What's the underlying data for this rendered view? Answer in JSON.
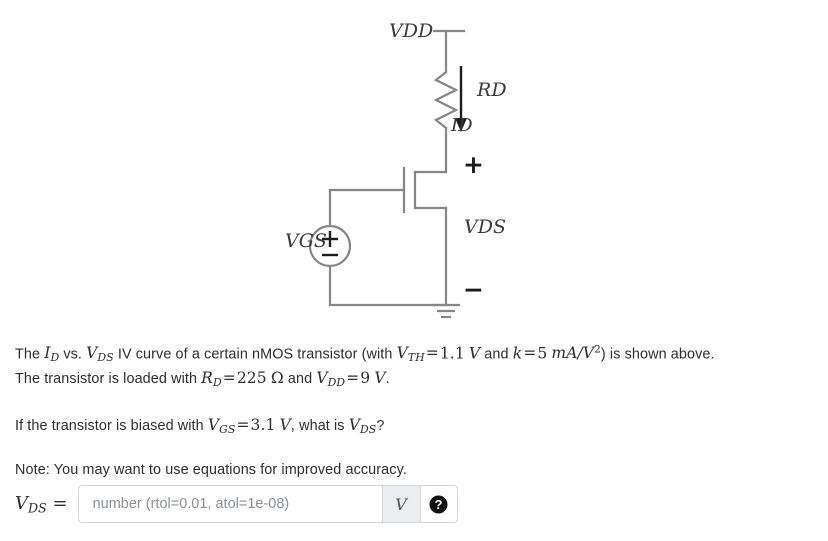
{
  "circuit": {
    "title": "nMOS common-source amplifier with drain resistor",
    "labels": {
      "vdd": "V",
      "vdd_sub": "DD",
      "rd": "R",
      "rd_sub": "D",
      "id": "I",
      "id_sub": "D",
      "vds": "V",
      "vds_sub": "DS",
      "vgs": "V",
      "vgs_sub": "GS",
      "polarity_plus": "+",
      "polarity_minus": "−",
      "source_plus": "+",
      "source_minus": "−"
    },
    "wire_color": "#868686",
    "label_color": "#3a3a3a"
  },
  "problem": {
    "statement": {
      "s1": "The ",
      "id": "I",
      "id_sub": "D",
      "s2": " vs. ",
      "vds": "V",
      "vds_sub": "DS",
      "s3": " IV curve of a certain nMOS transistor (with ",
      "vth": "V",
      "vth_sub": "TH",
      "eq1": "=",
      "vth_value": "1.1",
      "volt_unit": "V",
      "s4": " and ",
      "k": "k",
      "eq2": "=",
      "k_value": "5",
      "k_unit": "mA/V",
      "k_unit_exp": "2",
      "s5": ") is shown above.",
      "s6": "The transistor is loaded with ",
      "rd": "R",
      "rd_sub": "D",
      "eq3": "=",
      "rd_value": "225",
      "ohm_unit": "Ω",
      "s7": " and ",
      "vdd": "V",
      "vdd_sub": "DD",
      "eq4": "=",
      "vdd_value": "9",
      "vdd_unit": "V",
      "s8": "."
    },
    "question": {
      "q1": "If the transistor is biased with ",
      "vgs": "V",
      "vgs_sub": "GS",
      "eq": "=",
      "vgs_value": "3.1",
      "unit": "V",
      "q2": ", what is ",
      "vds": "V",
      "vds_sub": "DS",
      "q3": "?"
    },
    "note": "Note: You may want to use equations for improved accuracy."
  },
  "answer": {
    "label_var": "V",
    "label_sub": "DS",
    "label_eq": "=",
    "input_value": "",
    "input_placeholder": "number (rtol=0.01, atol=1e-08)",
    "unit": "V",
    "help_icon": "question-mark-circle-icon",
    "border_color": "#d4d7d9",
    "addon_background": "#eceef0"
  }
}
